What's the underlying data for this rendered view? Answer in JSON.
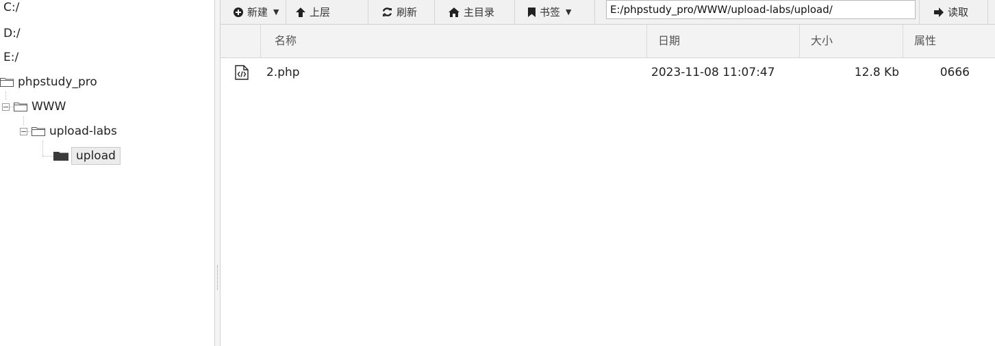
{
  "tree": {
    "drives": [
      "C:/",
      "D:/",
      "E:/"
    ],
    "nodes": [
      {
        "label": "phpstudy_pro"
      },
      {
        "label": "WWW"
      },
      {
        "label": "upload-labs"
      },
      {
        "label": "upload",
        "selected": true
      }
    ]
  },
  "toolbar": {
    "new_label": "新建",
    "up_label": "上层",
    "refresh_label": "刷新",
    "home_label": "主目录",
    "bookmark_label": "书签",
    "path_value": "E:/phpstudy_pro/WWW/upload-labs/upload/",
    "read_label": "读取"
  },
  "table": {
    "columns": [
      "名称",
      "日期",
      "大小",
      "属性"
    ],
    "rows": [
      {
        "icon": "php-file-icon",
        "name": "2.php",
        "date": "2023-11-08 11:07:47",
        "size": "12.8 Kb",
        "attr": "0666"
      }
    ]
  },
  "colors": {
    "toolbar_bg": "#f1f1f1",
    "header_bg": "#f3f3f3",
    "selected_bg": "#ececec"
  }
}
